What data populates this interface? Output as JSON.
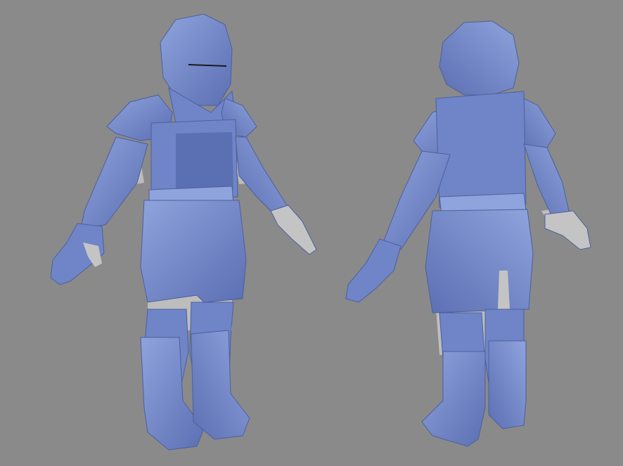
{
  "scene": {
    "background_color": "#8a8a8a",
    "armor_color": "#6f85c8",
    "armor_light_color": "#8fa3dd",
    "armor_dark_color": "#4d5f9c",
    "body_color": "#c4c4c4",
    "models": [
      {
        "view": "front"
      },
      {
        "view": "back"
      }
    ]
  }
}
